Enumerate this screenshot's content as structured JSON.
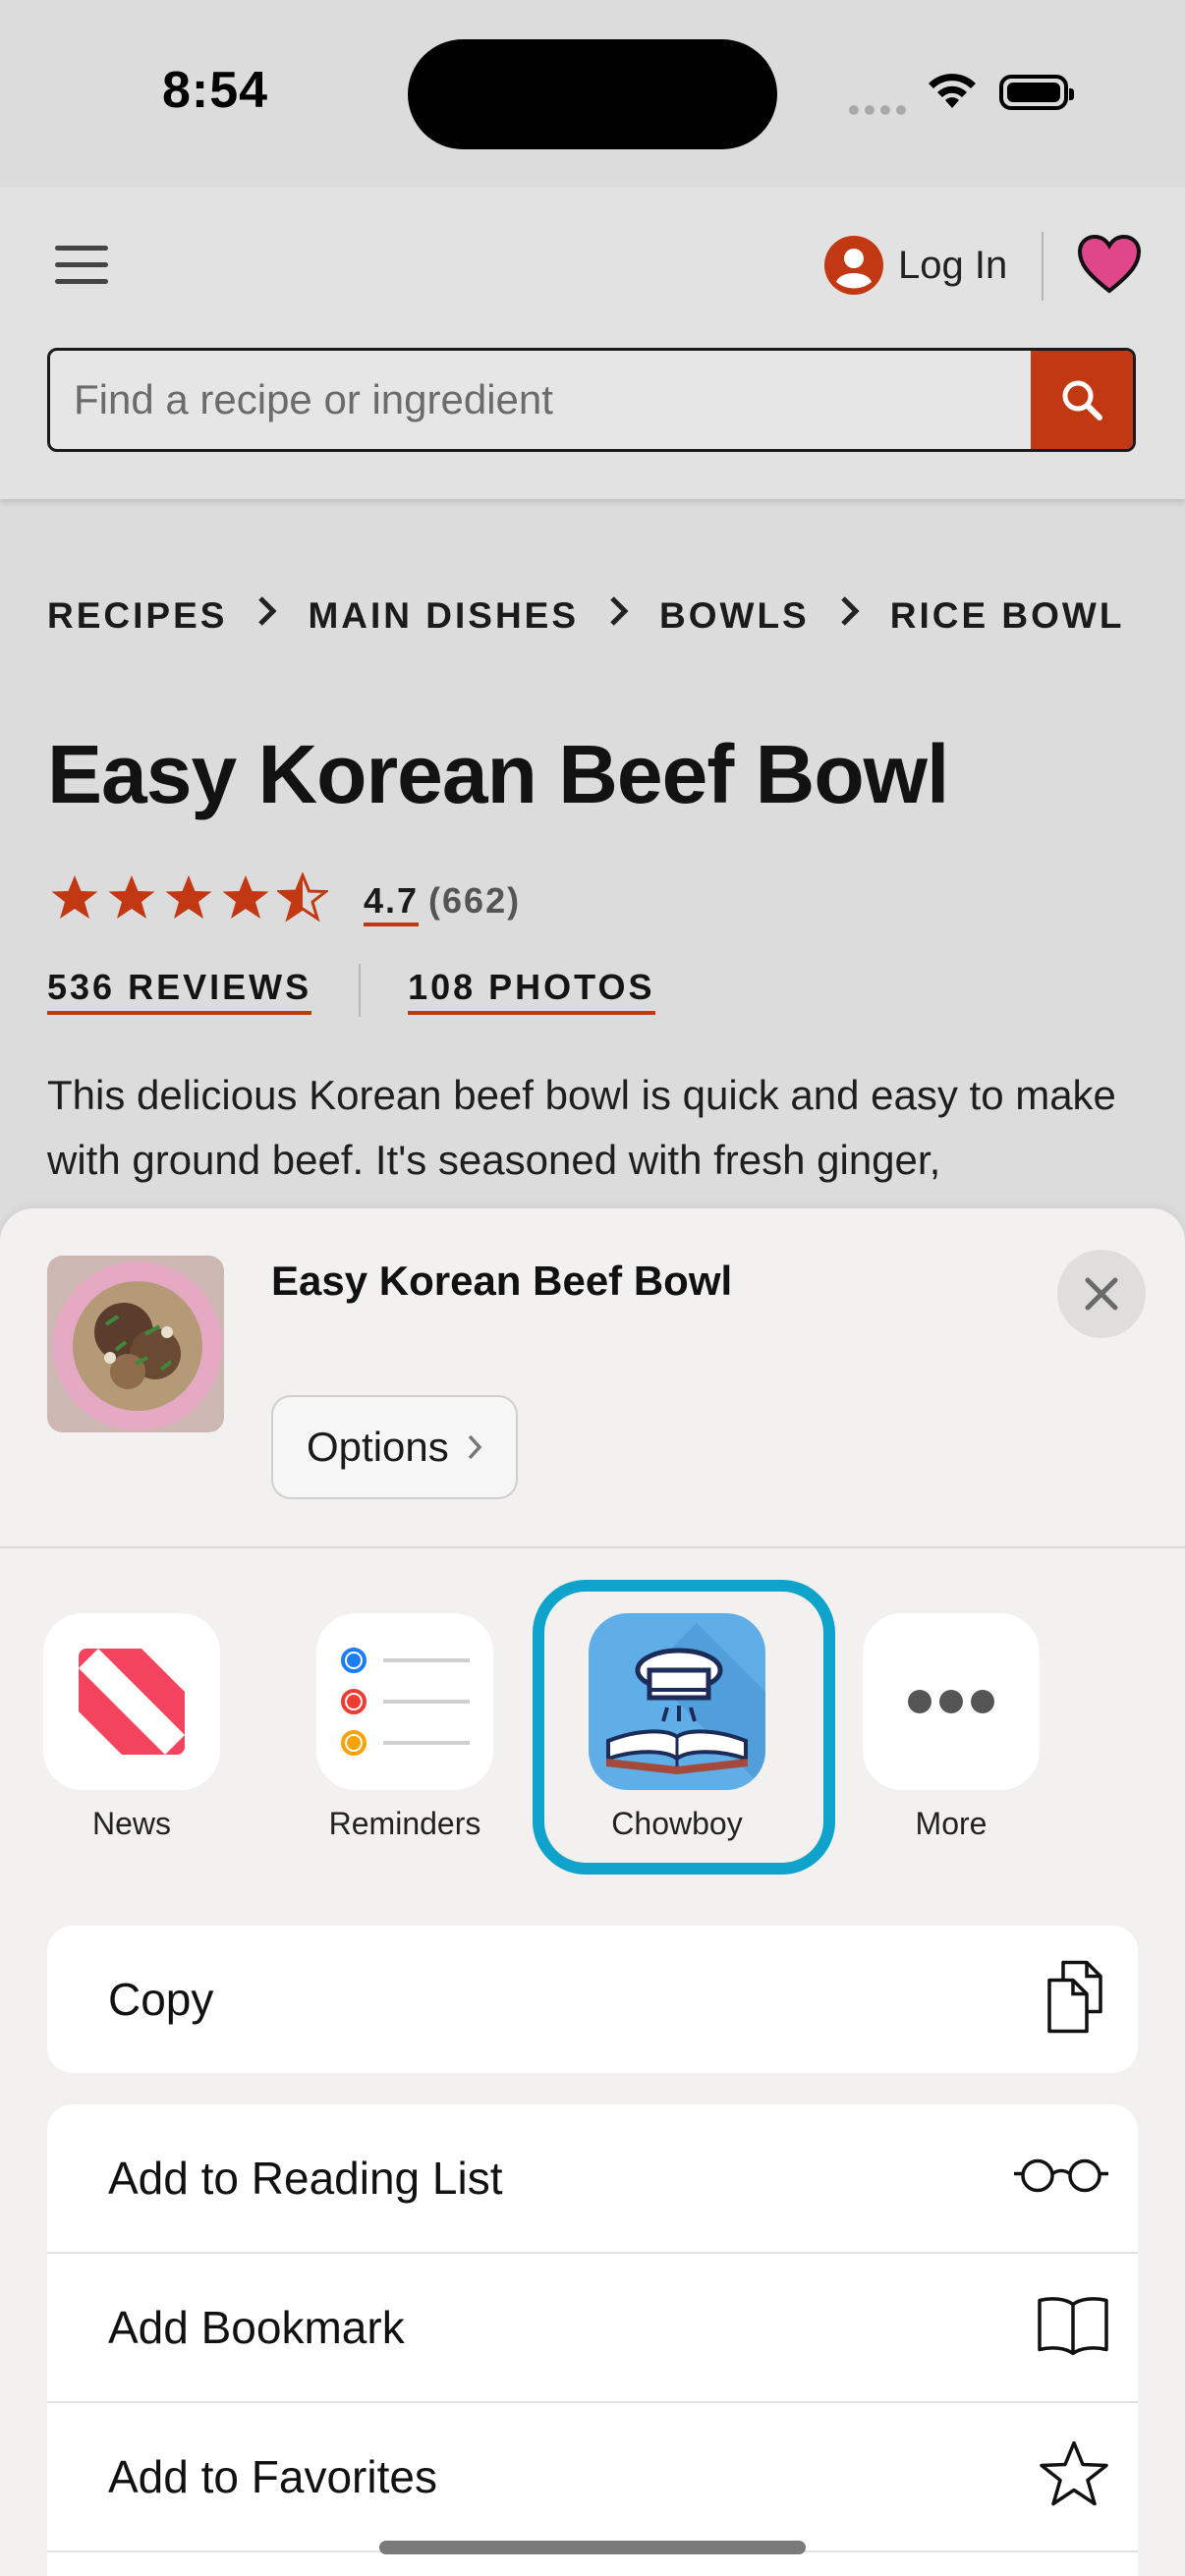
{
  "status": {
    "time": "8:54"
  },
  "header": {
    "login_label": "Log In",
    "search_placeholder": "Find a recipe or ingredient"
  },
  "breadcrumbs": [
    "RECIPES",
    "MAIN DISHES",
    "BOWLS",
    "RICE BOWL"
  ],
  "recipe": {
    "title": "Easy Korean Beef Bowl",
    "rating": "4.7",
    "rating_value": 4.7,
    "rating_count": "(662)",
    "reviews_link": "536 REVIEWS",
    "photos_link": "108 PHOTOS",
    "description": "This delicious Korean beef bowl is quick and easy to make with ground beef. It's seasoned with fresh ginger,"
  },
  "share_sheet": {
    "title": "Easy Korean Beef Bowl",
    "options_label": "Options",
    "apps": [
      {
        "label": "News",
        "icon": "news-icon"
      },
      {
        "label": "Reminders",
        "icon": "reminders-icon"
      },
      {
        "label": "Chowboy",
        "icon": "chowboy-icon"
      },
      {
        "label": "More",
        "icon": "more-icon"
      }
    ],
    "actions": [
      {
        "label": "Copy",
        "icon": "copy-icon"
      },
      {
        "label": "Add to Reading List",
        "icon": "glasses-icon"
      },
      {
        "label": "Add Bookmark",
        "icon": "book-icon"
      },
      {
        "label": "Add to Favorites",
        "icon": "star-icon"
      }
    ]
  },
  "colors": {
    "brand_accent": "#c23812",
    "highlight_ring": "#0fa3cc",
    "star": "#c23812"
  }
}
